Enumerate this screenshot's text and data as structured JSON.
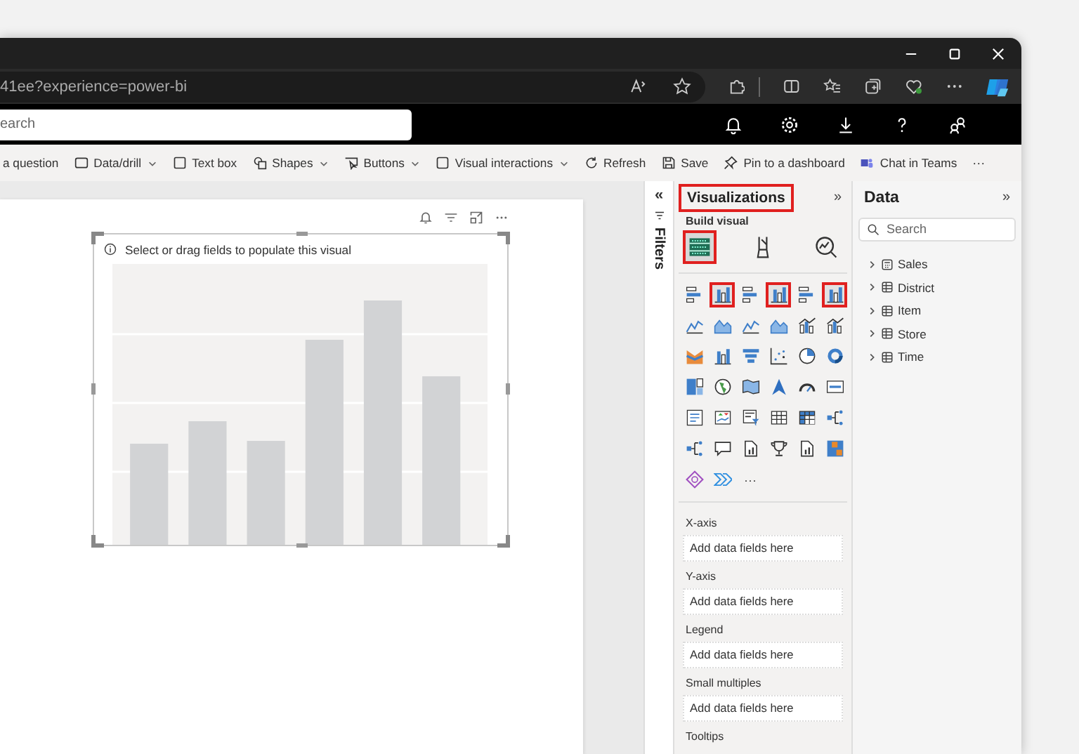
{
  "browser": {
    "address": "41ee?experience=power-bi"
  },
  "header": {
    "search_value": "earch"
  },
  "toolbar": [
    {
      "label": "a question",
      "dropdown": false,
      "kind": "plain"
    },
    {
      "label": "Data/drill",
      "dropdown": true,
      "kind": "data"
    },
    {
      "label": "Text box",
      "dropdown": false,
      "kind": "textbox"
    },
    {
      "label": "Shapes",
      "dropdown": true,
      "kind": "shapes"
    },
    {
      "label": "Buttons",
      "dropdown": true,
      "kind": "buttons"
    },
    {
      "label": "Visual interactions",
      "dropdown": true,
      "kind": "interactions"
    },
    {
      "label": "Refresh",
      "dropdown": false,
      "kind": "refresh"
    },
    {
      "label": "Save",
      "dropdown": false,
      "kind": "save"
    },
    {
      "label": "Pin to a dashboard",
      "dropdown": false,
      "kind": "pin"
    },
    {
      "label": "Chat in Teams",
      "dropdown": false,
      "kind": "teams"
    }
  ],
  "toolbar_more": "···",
  "visual": {
    "message": "Select or drag fields to populate this visual"
  },
  "filters": {
    "label": "Filters",
    "collapse": "«"
  },
  "visualizations": {
    "title": "Visualizations",
    "title_highlighted": true,
    "expand": "»",
    "subtitle": "Build visual",
    "build_tabs": [
      {
        "kind": "fields",
        "selected": true,
        "highlighted": true
      },
      {
        "kind": "format",
        "selected": false,
        "highlighted": false
      },
      {
        "kind": "analytics",
        "selected": false,
        "highlighted": false
      }
    ],
    "types": [
      {
        "kind": "hbar",
        "highlighted": false
      },
      {
        "kind": "vbar",
        "highlighted": true
      },
      {
        "kind": "hbar",
        "highlighted": false
      },
      {
        "kind": "vbar",
        "highlighted": true
      },
      {
        "kind": "hbar",
        "highlighted": false
      },
      {
        "kind": "vbar",
        "highlighted": true
      },
      {
        "kind": "line",
        "highlighted": false
      },
      {
        "kind": "area",
        "highlighted": false
      },
      {
        "kind": "line",
        "highlighted": false
      },
      {
        "kind": "area",
        "highlighted": false
      },
      {
        "kind": "combo",
        "highlighted": false
      },
      {
        "kind": "combo",
        "highlighted": false
      },
      {
        "kind": "ribbon",
        "highlighted": false
      },
      {
        "kind": "vbar",
        "highlighted": false
      },
      {
        "kind": "funnel",
        "highlighted": false
      },
      {
        "kind": "scatter",
        "highlighted": false
      },
      {
        "kind": "pie",
        "highlighted": false
      },
      {
        "kind": "donut",
        "highlighted": false
      },
      {
        "kind": "treemap",
        "highlighted": false
      },
      {
        "kind": "globe",
        "highlighted": false
      },
      {
        "kind": "map",
        "highlighted": false
      },
      {
        "kind": "arrow",
        "highlighted": false
      },
      {
        "kind": "gauge",
        "highlighted": false
      },
      {
        "kind": "card",
        "highlighted": false
      },
      {
        "kind": "lines",
        "highlighted": false
      },
      {
        "kind": "kpi",
        "highlighted": false
      },
      {
        "kind": "slicer",
        "highlighted": false
      },
      {
        "kind": "table",
        "highlighted": false
      },
      {
        "kind": "matrix",
        "highlighted": false
      },
      {
        "kind": "tree",
        "highlighted": false
      },
      {
        "kind": "tree",
        "highlighted": false
      },
      {
        "kind": "speech",
        "highlighted": false
      },
      {
        "kind": "doc",
        "highlighted": false
      },
      {
        "kind": "trophy",
        "highlighted": false
      },
      {
        "kind": "doc",
        "highlighted": false
      },
      {
        "kind": "apps",
        "highlighted": false
      },
      {
        "kind": "diamond",
        "highlighted": false
      },
      {
        "kind": "chevrons",
        "highlighted": false
      }
    ],
    "more": "···",
    "wells": [
      {
        "label": "X-axis",
        "placeholder": "Add data fields here"
      },
      {
        "label": "Y-axis",
        "placeholder": "Add data fields here"
      },
      {
        "label": "Legend",
        "placeholder": "Add data fields here"
      },
      {
        "label": "Small multiples",
        "placeholder": "Add data fields here"
      }
    ],
    "last_well_label": "Tooltips"
  },
  "data": {
    "title": "Data",
    "expand": "»",
    "search_placeholder": "Search",
    "tables": [
      {
        "name": "Sales",
        "kind": "calc",
        "expanded": false
      },
      {
        "name": "District",
        "kind": "table",
        "expanded": false
      },
      {
        "name": "Item",
        "kind": "table",
        "expanded": false
      },
      {
        "name": "Store",
        "kind": "table",
        "expanded": false
      },
      {
        "name": "Time",
        "kind": "table",
        "expanded": false
      }
    ]
  }
}
